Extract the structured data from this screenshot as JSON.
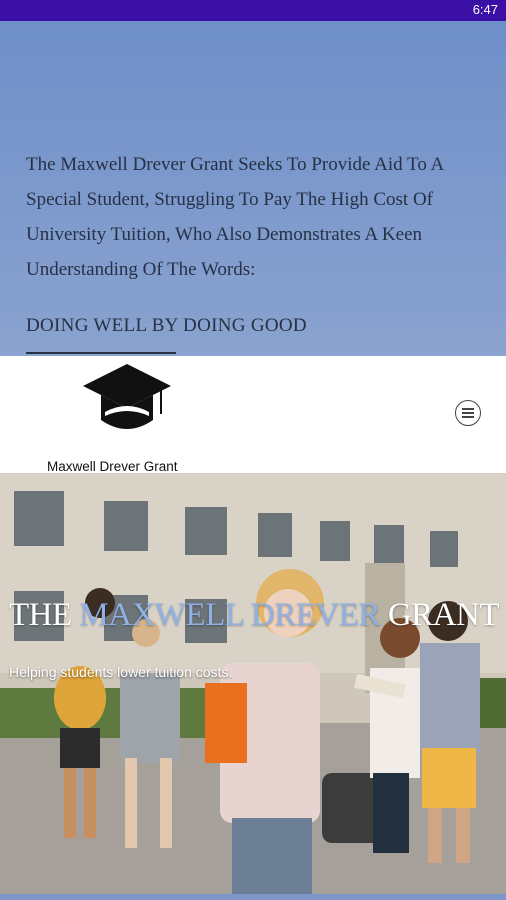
{
  "status_bar": {
    "time": "6:47",
    "background": "#3a0fa6"
  },
  "intro": {
    "paragraph": "The Maxwell Drever Grant Seeks To Provide Aid To A Special Student, Struggling To Pay The High Cost Of University Tuition, Who Also Demonstrates A Keen Understanding Of The Words:",
    "motto": "DOING WELL BY DOING GOOD",
    "background": "#7d98c8"
  },
  "header": {
    "logo_icon": "graduation-cap-icon",
    "logo_text": "Maxwell Drever Grant",
    "menu_icon": "hamburger-menu-icon"
  },
  "hero": {
    "title_part1": "THE ",
    "title_part2": "MAXWELL DREVER",
    "title_part3": " GRANT",
    "subtitle": "Helping students lower tuition costs.",
    "accent_color": "#8fb1e6"
  }
}
